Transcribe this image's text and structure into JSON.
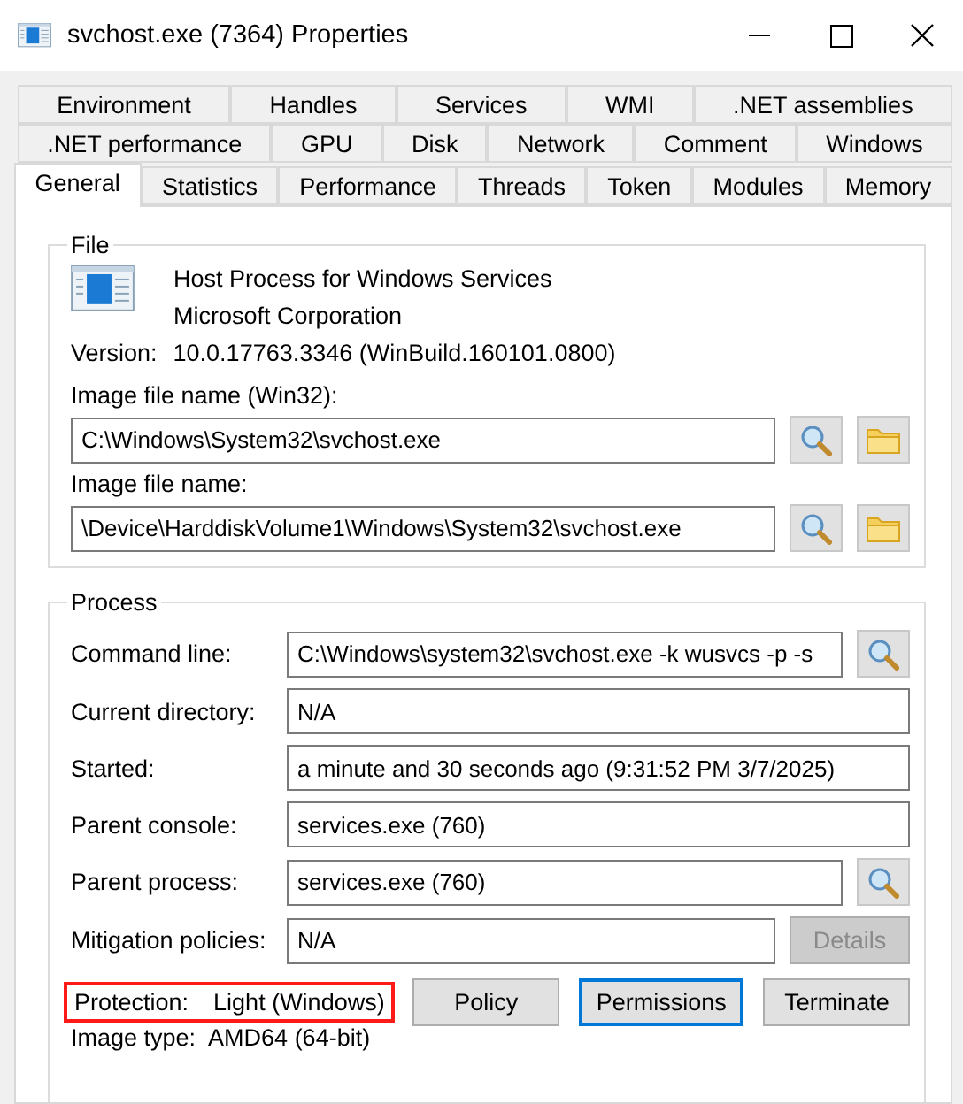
{
  "window": {
    "title": "svchost.exe (7364) Properties"
  },
  "tab_rows": [
    {
      "tabs": [
        {
          "label": "Environment",
          "selected": false
        },
        {
          "label": "Handles",
          "selected": false
        },
        {
          "label": "Services",
          "selected": false
        },
        {
          "label": "WMI",
          "selected": false
        },
        {
          "label": ".NET assemblies",
          "selected": false
        }
      ]
    },
    {
      "tabs": [
        {
          "label": ".NET performance",
          "selected": false
        },
        {
          "label": "GPU",
          "selected": false
        },
        {
          "label": "Disk",
          "selected": false
        },
        {
          "label": "Network",
          "selected": false
        },
        {
          "label": "Comment",
          "selected": false
        },
        {
          "label": "Windows",
          "selected": false
        }
      ]
    },
    {
      "tabs": [
        {
          "label": "General",
          "selected": true
        },
        {
          "label": "Statistics",
          "selected": false
        },
        {
          "label": "Performance",
          "selected": false
        },
        {
          "label": "Threads",
          "selected": false
        },
        {
          "label": "Token",
          "selected": false
        },
        {
          "label": "Modules",
          "selected": false
        },
        {
          "label": "Memory",
          "selected": false
        }
      ]
    }
  ],
  "file": {
    "title": "File",
    "description": "Host Process for Windows Services",
    "company": "Microsoft Corporation",
    "version_label": "Version:",
    "version": "10.0.17763.3346 (WinBuild.160101.0800)",
    "paths": [
      {
        "label": "Image file name (Win32):",
        "value": "C:\\Windows\\System32\\svchost.exe"
      },
      {
        "label": "Image file name:",
        "value": "\\Device\\HarddiskVolume1\\Windows\\System32\\svchost.exe"
      }
    ]
  },
  "process": {
    "title": "Process",
    "rows": [
      {
        "label": "Command line:",
        "value": "C:\\Windows\\system32\\svchost.exe -k wusvcs -p -s",
        "kind": "search"
      },
      {
        "label": "Current directory:",
        "value": "N/A",
        "kind": "plain"
      },
      {
        "label": "Started:",
        "value": "a minute and 30 seconds ago (9:31:52 PM 3/7/2025)",
        "kind": "plain"
      },
      {
        "label": "Parent console:",
        "value": "services.exe (760)",
        "kind": "plain"
      },
      {
        "label": "Parent process:",
        "value": "services.exe (760)",
        "kind": "search"
      },
      {
        "label": "Mitigation policies:",
        "value": "N/A",
        "kind": "button",
        "button": {
          "label": "Details",
          "disabled": true
        }
      }
    ],
    "protection": {
      "label": "Protection:",
      "value": "Light (Windows)",
      "highlighted": true
    },
    "buttons": [
      {
        "label": "Policy",
        "focused": false
      },
      {
        "label": "Permissions",
        "focused": true
      },
      {
        "label": "Terminate",
        "focused": false
      }
    ],
    "image_type": {
      "label": "Image type:",
      "value": "AMD64 (64-bit)"
    }
  }
}
